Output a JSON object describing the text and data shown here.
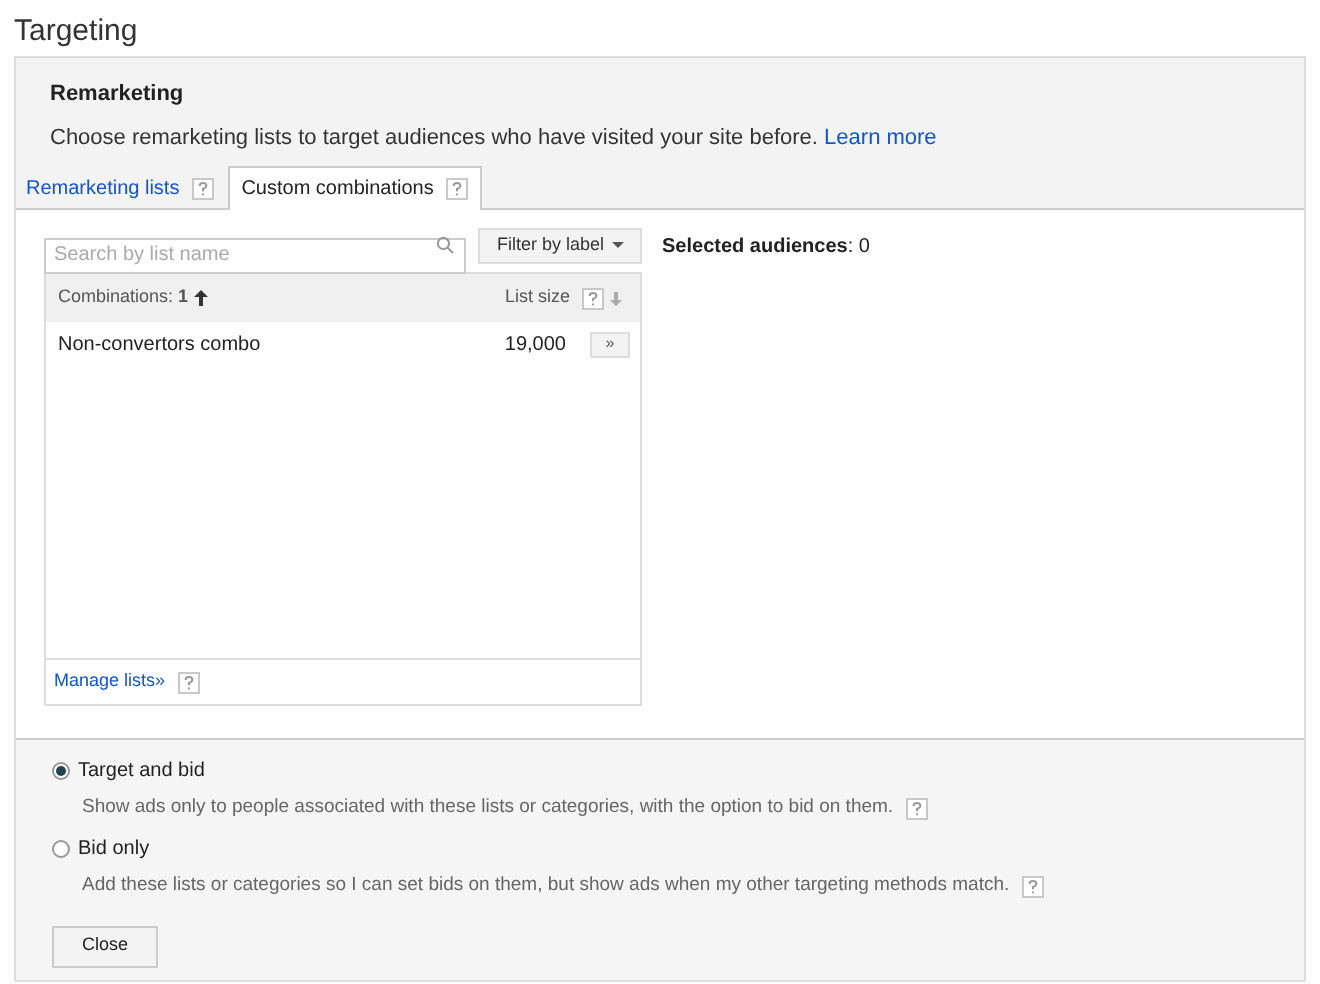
{
  "page_title": "Targeting",
  "section": {
    "title": "Remarketing",
    "description": "Choose remarketing lists to target audiences who have visited your site before.",
    "link": "Learn more"
  },
  "tabs": [
    {
      "label": "Remarketing lists",
      "selected": false
    },
    {
      "label": "Custom combinations",
      "selected": true
    }
  ],
  "search": {
    "placeholder": "Search by list name"
  },
  "filter_button": "Filter by label",
  "table": {
    "columns": [
      "Combinations: **1**",
      "List size"
    ],
    "rows": [
      {
        "name": "Non-convertors combo",
        "size": "19,000",
        "action": "»"
      }
    ]
  },
  "manage_link": "Manage lists»",
  "selected_audiences": "**Selected audiences**: 0",
  "options": [
    {
      "label": "Target and bid",
      "description": "Show ads only to people associated with these lists or categories, with the option to bid on them.",
      "selected": true
    },
    {
      "label": "Bid only",
      "description": "Add these lists or categories so I can set bids on them, but show ads when my other targeting methods match.",
      "selected": false
    }
  ],
  "close_button": "Close"
}
